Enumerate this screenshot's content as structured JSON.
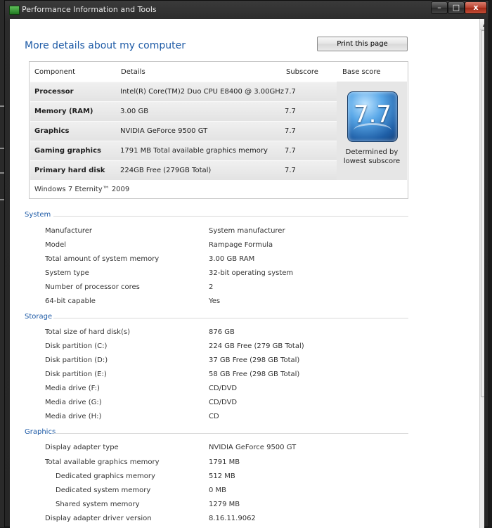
{
  "window": {
    "title": "Performance Information and Tools",
    "min_glyph": "–",
    "max_glyph": "□",
    "close_glyph": "x"
  },
  "page": {
    "heading": "More details about my computer",
    "print_button": "Print this page"
  },
  "score_table": {
    "headers": [
      "Component",
      "Details",
      "Subscore",
      "Base score"
    ],
    "rows": [
      {
        "component": "Processor",
        "details": "Intel(R) Core(TM)2 Duo CPU E8400 @ 3.00GHz",
        "subscore": "7.7"
      },
      {
        "component": "Memory (RAM)",
        "details": "3.00 GB",
        "subscore": "7.7"
      },
      {
        "component": "Graphics",
        "details": "NVIDIA GeForce 9500 GT",
        "subscore": "7.7"
      },
      {
        "component": "Gaming graphics",
        "details": "1791 MB Total available graphics memory",
        "subscore": "7.7"
      },
      {
        "component": "Primary hard disk",
        "details": "224GB Free (279GB Total)",
        "subscore": "7.7"
      }
    ],
    "base_score": "7.7",
    "base_label_line1": "Determined by",
    "base_label_line2": "lowest subscore",
    "os": "Windows 7 Eternity™ 2009"
  },
  "sections": {
    "system": {
      "title": "System",
      "items": [
        {
          "label": "Manufacturer",
          "value": "System manufacturer"
        },
        {
          "label": "Model",
          "value": "Rampage Formula"
        },
        {
          "label": "Total amount of system memory",
          "value": "3.00 GB RAM"
        },
        {
          "label": "System type",
          "value": "32-bit operating system"
        },
        {
          "label": "Number of processor cores",
          "value": "2"
        },
        {
          "label": "64-bit capable",
          "value": "Yes"
        }
      ]
    },
    "storage": {
      "title": "Storage",
      "items": [
        {
          "label": "Total size of hard disk(s)",
          "value": "876 GB"
        },
        {
          "label": "Disk partition (C:)",
          "value": "224 GB Free (279 GB Total)"
        },
        {
          "label": "Disk partition (D:)",
          "value": "37 GB Free (298 GB Total)"
        },
        {
          "label": "Disk partition (E:)",
          "value": "58 GB Free (298 GB Total)"
        },
        {
          "label": "Media drive (F:)",
          "value": "CD/DVD"
        },
        {
          "label": "Media drive (G:)",
          "value": "CD/DVD"
        },
        {
          "label": "Media drive (H:)",
          "value": "CD"
        }
      ]
    },
    "graphics": {
      "title": "Graphics",
      "items": [
        {
          "label": "Display adapter type",
          "value": "NVIDIA GeForce 9500 GT"
        },
        {
          "label": "Total available graphics memory",
          "value": "1791 MB"
        },
        {
          "label": "Dedicated graphics memory",
          "value": "512 MB"
        },
        {
          "label": "Dedicated system memory",
          "value": "0 MB"
        },
        {
          "label": "Shared system memory",
          "value": "1279 MB"
        },
        {
          "label": "Display adapter driver version",
          "value": "8.16.11.9062"
        }
      ]
    }
  }
}
